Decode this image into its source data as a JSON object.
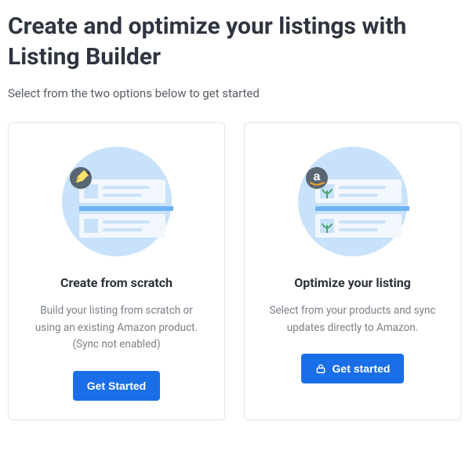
{
  "header": {
    "title": "Create and optimize your listings with Listing Builder",
    "subtitle": "Select from the two options below to get started"
  },
  "cards": [
    {
      "title": "Create from scratch",
      "desc": "Build your listing from scratch or using an existing Amazon product. (Sync not enabled)",
      "cta": "Get Started"
    },
    {
      "title": "Optimize your listing",
      "desc": "Select from your products and sync updates directly to Amazon.",
      "cta": "Get started"
    }
  ]
}
